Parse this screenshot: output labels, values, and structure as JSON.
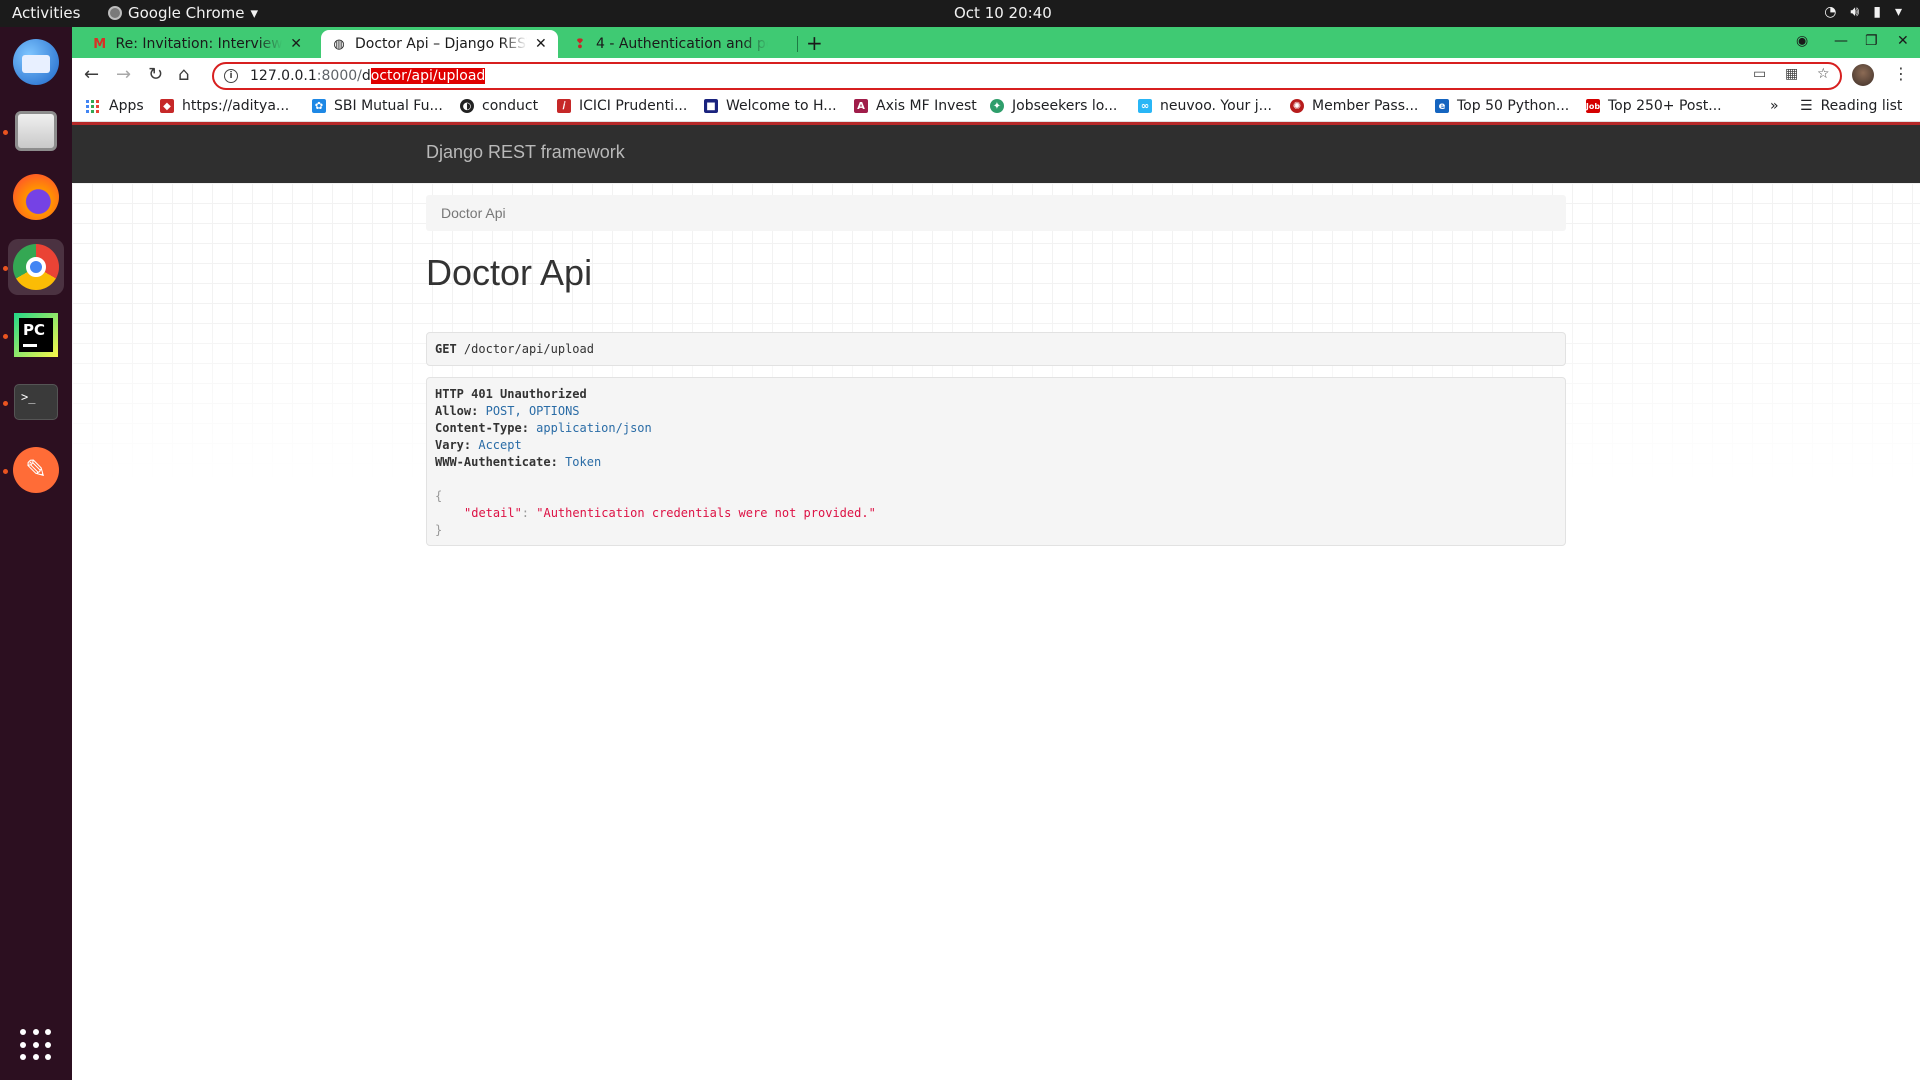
{
  "os": {
    "activities": "Activities",
    "app_name": "Google Chrome",
    "clock": "Oct 10  20:40"
  },
  "tabs": [
    {
      "title": "Re: Invitation: Interview D",
      "favicon": "gmail-icon"
    },
    {
      "title": "Doctor Api – Django REST",
      "favicon": "django-rest-icon",
      "active": true
    },
    {
      "title": "4 - Authentication and pe",
      "favicon": "doc-icon"
    }
  ],
  "address_bar": {
    "host": "127.0.0.1",
    "port": ":8000/",
    "path_first": "d",
    "path_selected": "octor/api/upload"
  },
  "bookmarks": {
    "apps": "Apps",
    "items": [
      "https://aditya...",
      "SBI Mutual Fu...",
      "conduct",
      "ICICI Prudenti...",
      "Welcome to H...",
      "Axis MF Invest",
      "Jobseekers lo...",
      "neuvoo. Your j...",
      "Member Pass...",
      "Top 50 Python...",
      "Top 250+ Post..."
    ],
    "overflow": "»",
    "reading_list": "Reading list"
  },
  "page": {
    "brand": "Django REST framework",
    "breadcrumb": "Doctor Api",
    "title": "Doctor Api",
    "request": {
      "method": "GET",
      "path": "/doctor/api/upload"
    },
    "response": {
      "status": "HTTP 401 Unauthorized",
      "headers": [
        {
          "key": "Allow:",
          "value": "POST, OPTIONS"
        },
        {
          "key": "Content-Type:",
          "value": "application/json"
        },
        {
          "key": "Vary:",
          "value": "Accept"
        },
        {
          "key": "WWW-Authenticate:",
          "value": "Token"
        }
      ],
      "open_brace": "{",
      "body_key": "\"detail\"",
      "colon": ": ",
      "body_value": "\"Authentication credentials were not provided.\"",
      "close_brace": "}"
    }
  },
  "colors": {
    "tabstrip": "#3fca73",
    "navbar": "#2f2f2f",
    "selection": "#e00000"
  }
}
